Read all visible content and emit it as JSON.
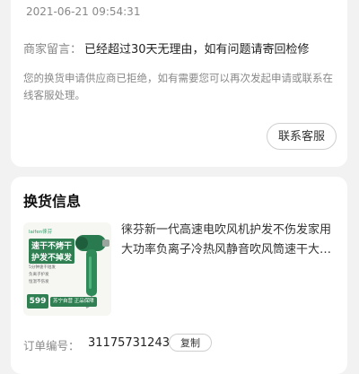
{
  "rejection_card": {
    "timestamp": "2021-06-21 09:54:31",
    "merchant_message_label": "商家留言：",
    "merchant_message": "已经超过30天无理由，如有问题请寄回检修",
    "notice": "您的换货申请供应商已拒绝，如有需要您可以再次发起申请或联系在线客服处理。",
    "contact_button": "联系客服"
  },
  "exchange_card": {
    "title": "换货信息",
    "product": {
      "name": "徕芬新一代高速电吹风机护发不伤发家用大功率负离子冷热风静音吹风筒速干大功率",
      "image": {
        "brand": "laifen徕芬",
        "tag_line1": "速干不烤干",
        "tag_line2": "护发不掉发",
        "features": [
          "5分钟速干短发",
          "负离子护发",
          "恒温不伤发"
        ],
        "price": "599",
        "badge": "苏宁自营 正品保障",
        "accent_color": "#2f7f52"
      }
    },
    "order_label": "订单编号：",
    "order_number": "31175731243",
    "copy_button": "复制"
  }
}
